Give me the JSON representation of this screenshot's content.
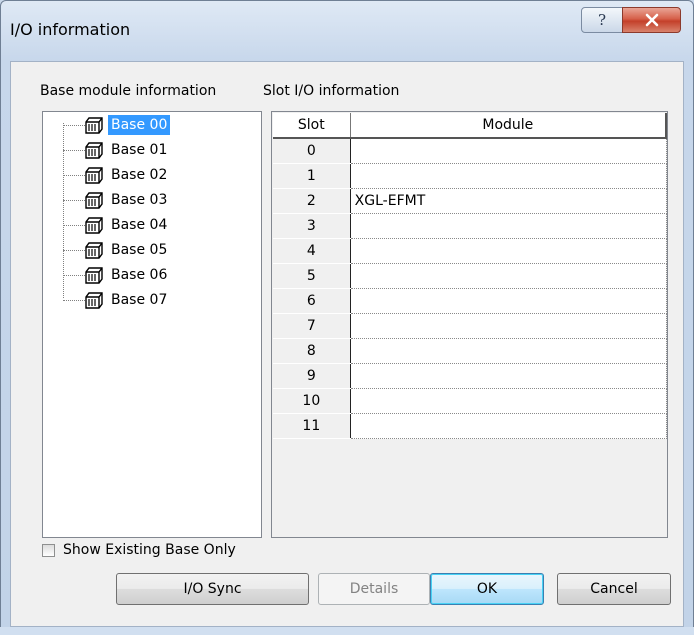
{
  "window": {
    "title": "I/O information",
    "help_glyph": "?",
    "close_glyph": "x"
  },
  "base_panel": {
    "label": "Base module information",
    "items": [
      "Base 00",
      "Base 01",
      "Base 02",
      "Base 03",
      "Base 04",
      "Base 05",
      "Base 06",
      "Base 07"
    ],
    "selected": "Base 00"
  },
  "slot_panel": {
    "label": "Slot I/O information",
    "columns": [
      "Slot",
      "Module"
    ],
    "rows": [
      {
        "slot": "0",
        "module": ""
      },
      {
        "slot": "1",
        "module": ""
      },
      {
        "slot": "2",
        "module": "XGL-EFMT"
      },
      {
        "slot": "3",
        "module": ""
      },
      {
        "slot": "4",
        "module": ""
      },
      {
        "slot": "5",
        "module": ""
      },
      {
        "slot": "6",
        "module": ""
      },
      {
        "slot": "7",
        "module": ""
      },
      {
        "slot": "8",
        "module": ""
      },
      {
        "slot": "9",
        "module": ""
      },
      {
        "slot": "10",
        "module": ""
      },
      {
        "slot": "11",
        "module": ""
      }
    ]
  },
  "options": {
    "show_existing_label": "Show Existing Base Only",
    "show_existing_checked": false
  },
  "buttons": {
    "io_sync": "I/O Sync",
    "details": "Details",
    "ok": "OK",
    "cancel": "Cancel"
  },
  "colors": {
    "selection": "#3399ff",
    "close_button": "#c4402a",
    "default_button_border": "#3c7fb1"
  },
  "icons": {
    "tree_item": "base-module-icon",
    "help": "help-icon",
    "close": "close-icon"
  }
}
